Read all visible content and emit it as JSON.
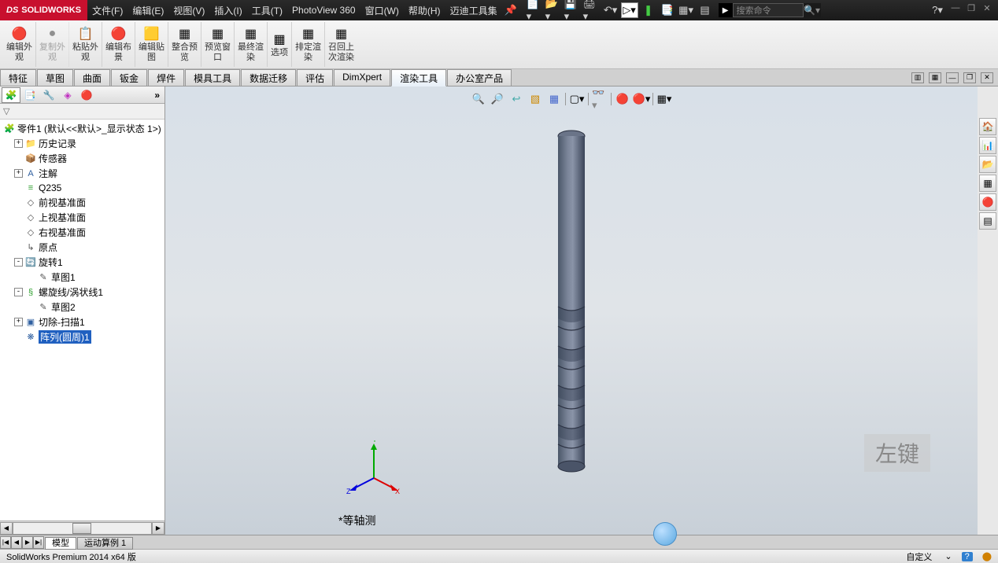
{
  "app": {
    "name": "SOLIDWORKS"
  },
  "menus": [
    "文件(F)",
    "编辑(E)",
    "视图(V)",
    "插入(I)",
    "工具(T)",
    "PhotoView 360",
    "窗口(W)",
    "帮助(H)",
    "迈迪工具集"
  ],
  "search_placeholder": "搜索命令",
  "ribbon": [
    {
      "label": "编辑外\n观",
      "icon": "🔴",
      "disabled": false
    },
    {
      "label": "复制外\n观",
      "icon": "●",
      "disabled": true
    },
    {
      "label": "粘贴外\n观",
      "icon": "📋",
      "disabled": false
    },
    {
      "label": "编辑布\n景",
      "icon": "🔴",
      "disabled": false
    },
    {
      "label": "编辑贴\n图",
      "icon": "🟨",
      "disabled": false
    },
    {
      "label": "整合预\n览",
      "icon": "▦",
      "disabled": false
    },
    {
      "label": "预览窗\n口",
      "icon": "▦",
      "disabled": false
    },
    {
      "label": "最终渲\n染",
      "icon": "▦",
      "disabled": false
    },
    {
      "label": "选项",
      "icon": "▦",
      "disabled": false
    },
    {
      "label": "排定渲\n染",
      "icon": "▦",
      "disabled": false
    },
    {
      "label": "召回上\n次渲染",
      "icon": "▦",
      "disabled": false
    }
  ],
  "tabs": [
    "特征",
    "草图",
    "曲面",
    "钣金",
    "焊件",
    "模具工具",
    "数据迁移",
    "评估",
    "DimXpert",
    "渲染工具",
    "办公室产品"
  ],
  "active_tab": "渲染工具",
  "tree_root": "零件1  (默认<<默认>_显示状态 1>)",
  "tree": [
    {
      "label": "历史记录",
      "icon": "📁",
      "indent": 2,
      "expand": "+",
      "color": "#c8a030"
    },
    {
      "label": "传感器",
      "icon": "📦",
      "indent": 2,
      "color": "#c8a030"
    },
    {
      "label": "注解",
      "icon": "A",
      "indent": 2,
      "expand": "+",
      "color": "#3060a0"
    },
    {
      "label": "Q235",
      "icon": "≡",
      "indent": 2,
      "color": "#30a030"
    },
    {
      "label": "前视基准面",
      "icon": "◇",
      "indent": 2
    },
    {
      "label": "上视基准面",
      "icon": "◇",
      "indent": 2
    },
    {
      "label": "右视基准面",
      "icon": "◇",
      "indent": 2
    },
    {
      "label": "原点",
      "icon": "↳",
      "indent": 2
    },
    {
      "label": "旋转1",
      "icon": "🔄",
      "indent": 2,
      "expand": "-",
      "color": "#d08030"
    },
    {
      "label": "草图1",
      "icon": "✎",
      "indent": 3
    },
    {
      "label": "螺旋线/涡状线1",
      "icon": "§",
      "indent": 2,
      "expand": "-",
      "color": "#30a030"
    },
    {
      "label": "草图2",
      "icon": "✎",
      "indent": 3
    },
    {
      "label": "切除-扫描1",
      "icon": "▣",
      "indent": 2,
      "expand": "+",
      "color": "#3060a0"
    },
    {
      "label": "阵列(圆周)1",
      "icon": "❋",
      "indent": 2,
      "selected": true,
      "color": "#3060a0"
    }
  ],
  "view_label": "*等轴测",
  "overlay_hint": "左键",
  "bottom_tabs": [
    "模型",
    "运动算例 1"
  ],
  "active_bottom_tab": "模型",
  "statusbar": {
    "left": "SolidWorks Premium 2014 x64 版",
    "right": [
      "自定义",
      "⌄",
      "?"
    ]
  }
}
